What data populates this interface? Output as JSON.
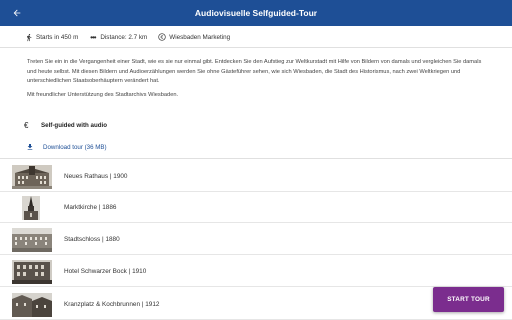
{
  "appbar": {
    "title": "Audiovisuelle Selfguided-Tour"
  },
  "meta": {
    "start": "Starts in 450 m",
    "distance": "Distance: 2.7 km",
    "provider": "Wiesbaden Marketing"
  },
  "description": "Treten Sie ein in die Vergangenheit einer Stadt, wie es sie nur einmal gibt. Entdecken Sie den Aufstieg zur Weltkurstadt mit Hilfe von Bildern von damals und vergleichen Sie damals und heute selbst. Mit diesen Bildern und Audioerzählungen werden Sie ohne Gästeführer sehen, wie sich Wiesbaden, die Stadt des Historismus, nach zwei Weltkriegen und unterschiedlichen Staatsoberhäuptern verändert hat.",
  "support": "Mit freundlicher Unterstützung des Stadtarchivs Wiesbaden.",
  "audio": {
    "currency_icon": "€",
    "label": "Self-guided with audio"
  },
  "download": {
    "label": "Download tour (36 MB)"
  },
  "stops": [
    {
      "label": "Neues Rathaus | 1900"
    },
    {
      "label": "Marktkirche | 1886"
    },
    {
      "label": "Stadtschloss | 1880"
    },
    {
      "label": "Hotel Schwarzer Bock | 1910"
    },
    {
      "label": "Kranzplatz & Kochbrunnen | 1912"
    }
  ],
  "fab": {
    "label": "START TOUR"
  },
  "colors": {
    "appbar": "#1e4f96",
    "fab": "#7b2d8e",
    "link": "#1e4f96"
  }
}
